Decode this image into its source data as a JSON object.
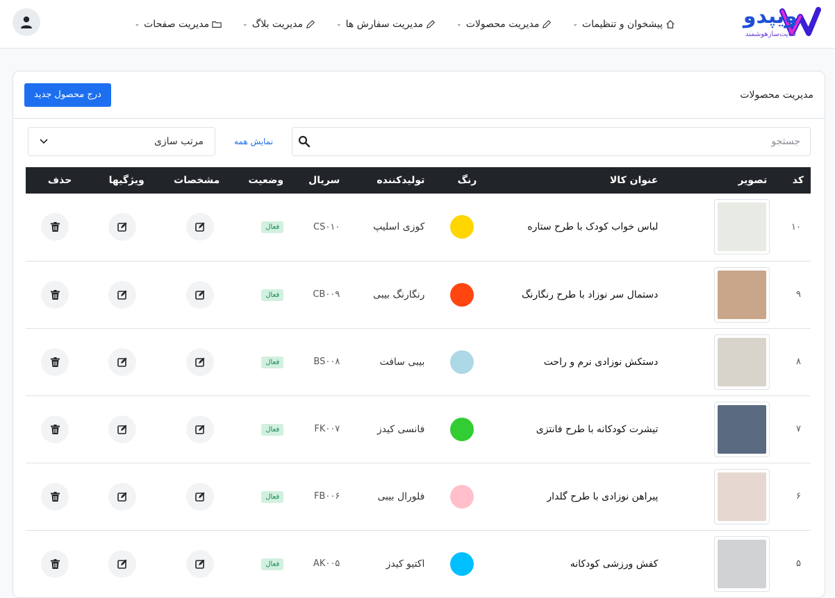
{
  "brand": {
    "name": "ویپدو",
    "tagline": "سایت‌سازهوشمند"
  },
  "nav": [
    {
      "label": "پیشخوان و تنظیمات",
      "icon": "home-icon"
    },
    {
      "label": "مدیریت محصولات",
      "icon": "pencil-icon"
    },
    {
      "label": "مدیریت سفارش ها",
      "icon": "pencil-icon"
    },
    {
      "label": "مدیریت بلاگ",
      "icon": "pencil-icon"
    },
    {
      "label": "مدیریت صفحات",
      "icon": "folder-icon"
    }
  ],
  "card": {
    "title": "مدیریت محصولات",
    "add_button": "درج محصول جدید"
  },
  "toolbar": {
    "search_placeholder": "جستجو",
    "show_all": "نمایش همه",
    "sort_label": "مرتب سازی"
  },
  "table": {
    "headers": {
      "code": "کد",
      "image": "تصویر",
      "title": "عنوان کالا",
      "color": "رنگ",
      "maker": "تولیدکننده",
      "serial": "سریال",
      "status": "وضعیت",
      "specs": "مشخصات",
      "attrs": "ویژگیها",
      "delete": "حذف"
    },
    "rows": [
      {
        "code": "۱۰",
        "title": "لباس خواب کودک با طرح ستاره",
        "color": "#ffd600",
        "maker": "کوزی اسلیپ",
        "serial": "CS۰۱۰",
        "status": "فعال",
        "thumb": "#e8ebe4"
      },
      {
        "code": "۹",
        "title": "دستمال سر نوزاد با طرح رنگارنگ",
        "color": "#ff4510",
        "maker": "رنگارنگ بیبی",
        "serial": "CB۰۰۹",
        "status": "فعال",
        "thumb": "#c9a58a"
      },
      {
        "code": "۸",
        "title": "دستکش نوزادی نرم و راحت",
        "color": "#add8e6",
        "maker": "بیبی سافت",
        "serial": "BS۰۰۸",
        "status": "فعال",
        "thumb": "#d8d4cc"
      },
      {
        "code": "۷",
        "title": "تیشرت کودکانه با طرح فانتزی",
        "color": "#32cd32",
        "maker": "فانسی کیدز",
        "serial": "FK۰۰۷",
        "status": "فعال",
        "thumb": "#5a6a80"
      },
      {
        "code": "۶",
        "title": "پیراهن نوزادی با طرح گلدار",
        "color": "#ffc0cb",
        "maker": "فلورال بیبی",
        "serial": "FB۰۰۶",
        "status": "فعال",
        "thumb": "#e6d8d0"
      },
      {
        "code": "۵",
        "title": "کفش ورزشی کودکانه",
        "color": "#00bfff",
        "maker": "اکتیو کیدز",
        "serial": "AK۰۰۵",
        "status": "فعال",
        "thumb": "#d0d2d4"
      }
    ]
  }
}
